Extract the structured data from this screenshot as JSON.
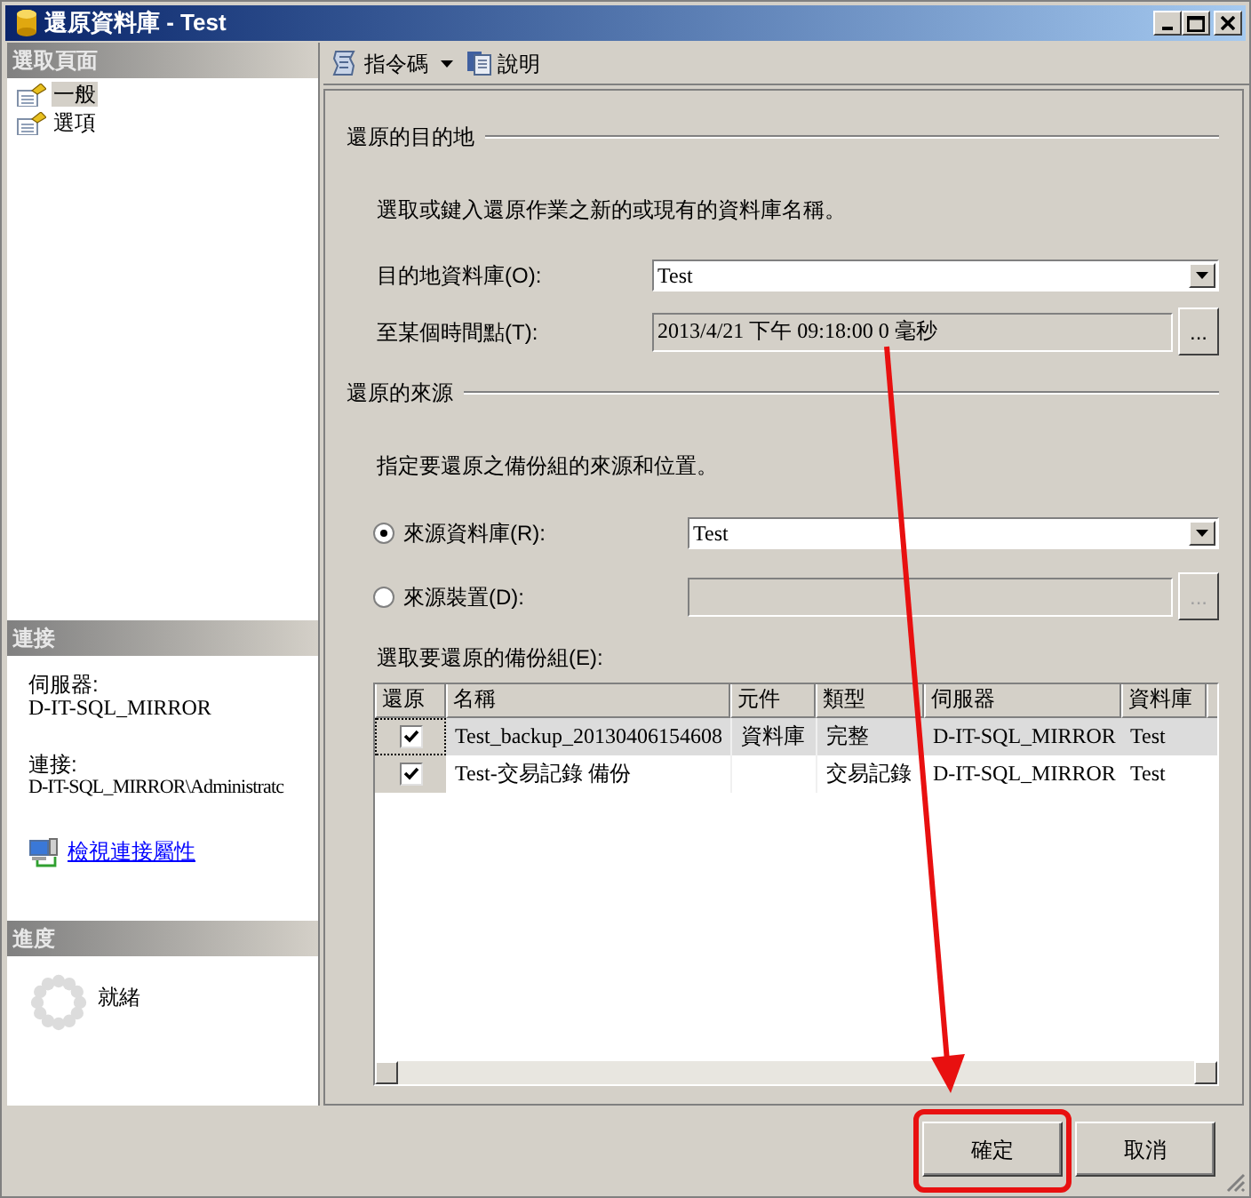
{
  "window": {
    "title": "還原資料庫 - Test"
  },
  "sidebar": {
    "header": "選取頁面",
    "pages": [
      {
        "label": "一般",
        "selected": true
      },
      {
        "label": "選項",
        "selected": false
      }
    ]
  },
  "connection": {
    "header": "連接",
    "server_label": "伺服器:",
    "server": "D-IT-SQL_MIRROR",
    "connection_label": "連接:",
    "connection": "D-IT-SQL_MIRROR\\Administratc",
    "link": "檢視連接屬性"
  },
  "progress": {
    "header": "進度",
    "status": "就緒"
  },
  "toolbar": {
    "script": "指令碼",
    "help": "說明"
  },
  "destination": {
    "title": "還原的目的地",
    "hint": "選取或鍵入還原作業之新的或現有的資料庫名稱。",
    "database_label": "目的地資料庫(O):",
    "database": "Test",
    "point_label": "至某個時間點(T):",
    "point": "2013/4/21 下午 09:18:00 0 毫秒",
    "browse": "..."
  },
  "source": {
    "title": "還原的來源",
    "hint": "指定要還原之備份組的來源和位置。",
    "options": [
      {
        "label": "來源資料庫(R):",
        "selected": true,
        "disabled": false,
        "value": "Test"
      },
      {
        "label": "來源裝置(D):",
        "selected": false,
        "disabled": true,
        "browse": "..."
      }
    ]
  },
  "backup_sets": {
    "label": "選取要還原的備份組(E):",
    "columns": [
      "還原",
      "名稱",
      "元件",
      "類型",
      "伺服器",
      "資料庫"
    ],
    "rows": [
      {
        "selected": true,
        "restore": true,
        "name": "Test_backup_20130406154608",
        "component": "資料庫",
        "type": "完整",
        "server": "D-IT-SQL_MIRROR",
        "database": "Test"
      },
      {
        "selected": false,
        "restore": true,
        "name": "Test-交易記錄  備份",
        "type": "交易記錄",
        "server": "D-IT-SQL_MIRROR",
        "database": "Test"
      }
    ]
  },
  "buttons": [
    {
      "label": "確定",
      "highlighted": true
    },
    {
      "label": "取消",
      "highlighted": false
    }
  ]
}
